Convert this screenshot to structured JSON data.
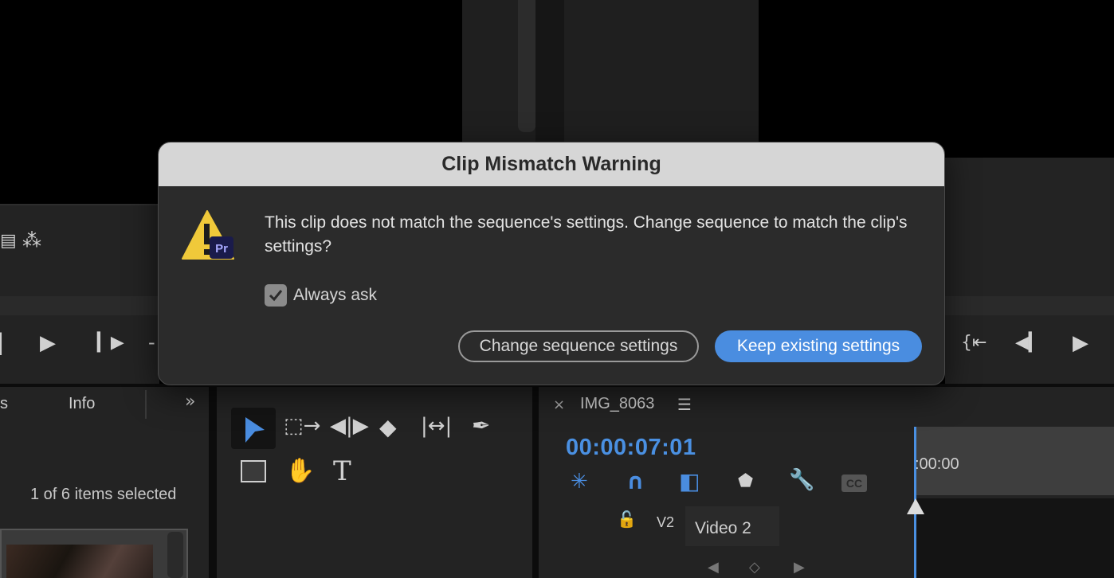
{
  "dialog": {
    "title": "Clip Mismatch Warning",
    "message": "This clip does not match the sequence's settings. Change sequence to match the clip's settings?",
    "checkbox_label": "Always ask",
    "checkbox_checked": true,
    "secondary_button": "Change sequence settings",
    "primary_button": "Keep existing settings",
    "badge_text": "Pr"
  },
  "project_panel": {
    "tab_partial": "s",
    "info_tab": "Info",
    "overflow_icon": "double-chevron-right-icon",
    "selection_status": "1 of 6 items selected"
  },
  "timeline": {
    "sequence_name": "IMG_8063",
    "timecode": "00:00:07:01",
    "ruler_label": ":00:00",
    "track_id": "V2",
    "track_name": "Video 2",
    "cc_label": "CC"
  },
  "colors": {
    "accent": "#4a8de0",
    "timecode": "#4a90e2",
    "warning": "#f0c93a",
    "badge_bg": "#1a1b4b"
  }
}
